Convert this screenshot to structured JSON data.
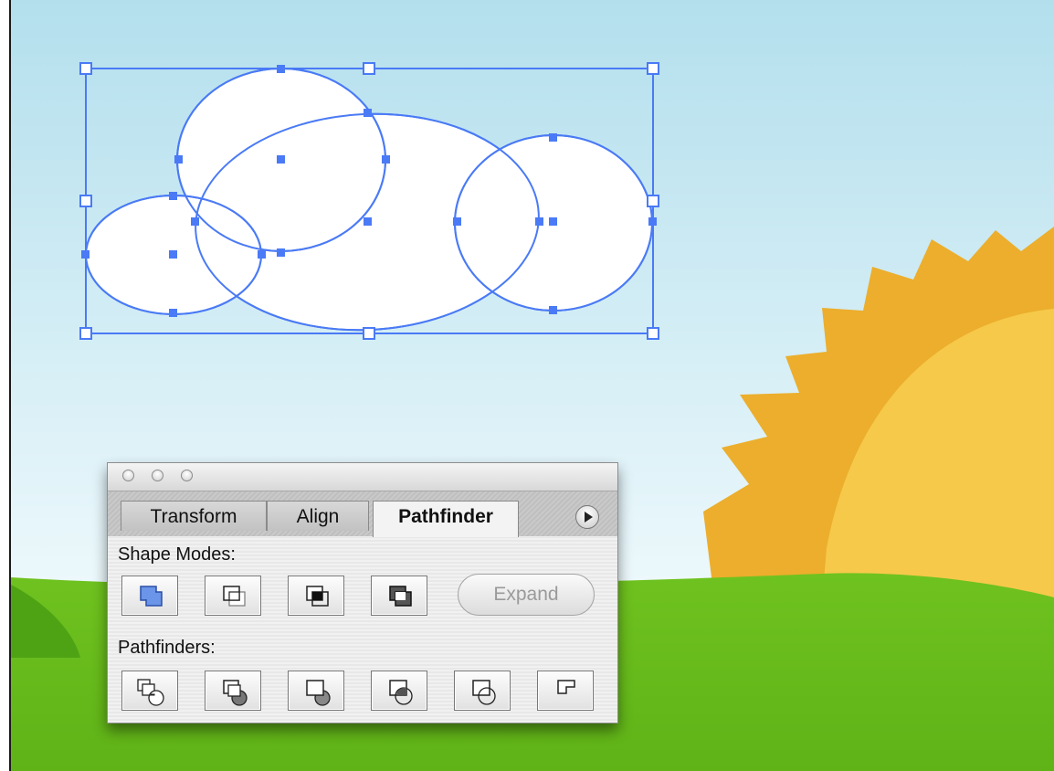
{
  "palette": {
    "tabs": [
      {
        "label": "Transform",
        "active": false
      },
      {
        "label": "Align",
        "active": false
      },
      {
        "label": "Pathfinder",
        "active": true
      }
    ],
    "shape_modes_label": "Shape Modes:",
    "shape_modes": [
      "add-to-shape-area-icon",
      "subtract-from-shape-area-icon",
      "intersect-shape-areas-icon",
      "exclude-overlapping-shape-areas-icon"
    ],
    "expand_label": "Expand",
    "expand_enabled": false,
    "pathfinders_label": "Pathfinders:",
    "pathfinders": [
      "divide-icon",
      "trim-icon",
      "merge-icon",
      "crop-icon",
      "outline-icon",
      "minus-back-icon"
    ]
  },
  "colors": {
    "selection": "#4a7af5",
    "sky_top": "#b5e0ee",
    "sky_bottom": "#edf8fb",
    "grass": "#6cc01e",
    "sun_rays": "#eeb02f",
    "sun_core": "#f6c94a"
  }
}
